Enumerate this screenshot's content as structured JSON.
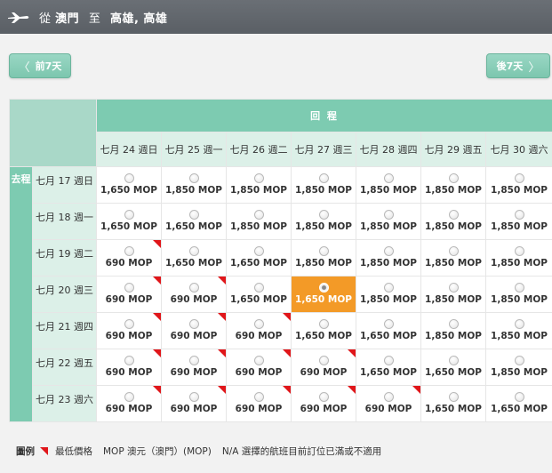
{
  "header": {
    "from": "澳門",
    "to_word": "至",
    "origin_prefix": "從",
    "destination": "高雄, 高雄"
  },
  "nav": {
    "prev_label": "前7天",
    "next_label": "後7天",
    "prev_chev": "〈",
    "next_chev": "〉"
  },
  "grid": {
    "return_title": "回 程",
    "outbound_label": "去程",
    "return_dates": [
      "七月 24 週日",
      "七月 25 週一",
      "七月 26 週二",
      "七月 27 週三",
      "七月 28 週四",
      "七月 29 週五",
      "七月 30 週六"
    ],
    "rows": [
      {
        "date": "七月 17 週日",
        "cells": [
          {
            "price": "1,650 MOP",
            "lowest": false,
            "selected": false
          },
          {
            "price": "1,850 MOP",
            "lowest": false,
            "selected": false
          },
          {
            "price": "1,850 MOP",
            "lowest": false,
            "selected": false
          },
          {
            "price": "1,850 MOP",
            "lowest": false,
            "selected": false
          },
          {
            "price": "1,850 MOP",
            "lowest": false,
            "selected": false
          },
          {
            "price": "1,850 MOP",
            "lowest": false,
            "selected": false
          },
          {
            "price": "1,850 MOP",
            "lowest": false,
            "selected": false
          }
        ]
      },
      {
        "date": "七月 18 週一",
        "cells": [
          {
            "price": "1,650 MOP",
            "lowest": false,
            "selected": false
          },
          {
            "price": "1,650 MOP",
            "lowest": false,
            "selected": false
          },
          {
            "price": "1,850 MOP",
            "lowest": false,
            "selected": false
          },
          {
            "price": "1,850 MOP",
            "lowest": false,
            "selected": false
          },
          {
            "price": "1,850 MOP",
            "lowest": false,
            "selected": false
          },
          {
            "price": "1,850 MOP",
            "lowest": false,
            "selected": false
          },
          {
            "price": "1,850 MOP",
            "lowest": false,
            "selected": false
          }
        ]
      },
      {
        "date": "七月 19 週二",
        "cells": [
          {
            "price": "690 MOP",
            "lowest": true,
            "selected": false
          },
          {
            "price": "1,650 MOP",
            "lowest": false,
            "selected": false
          },
          {
            "price": "1,650 MOP",
            "lowest": false,
            "selected": false
          },
          {
            "price": "1,850 MOP",
            "lowest": false,
            "selected": false
          },
          {
            "price": "1,850 MOP",
            "lowest": false,
            "selected": false
          },
          {
            "price": "1,850 MOP",
            "lowest": false,
            "selected": false
          },
          {
            "price": "1,850 MOP",
            "lowest": false,
            "selected": false
          }
        ]
      },
      {
        "date": "七月 20 週三",
        "cells": [
          {
            "price": "690 MOP",
            "lowest": true,
            "selected": false
          },
          {
            "price": "690 MOP",
            "lowest": true,
            "selected": false
          },
          {
            "price": "1,650 MOP",
            "lowest": false,
            "selected": false
          },
          {
            "price": "1,650 MOP",
            "lowest": false,
            "selected": true
          },
          {
            "price": "1,850 MOP",
            "lowest": false,
            "selected": false
          },
          {
            "price": "1,850 MOP",
            "lowest": false,
            "selected": false
          },
          {
            "price": "1,850 MOP",
            "lowest": false,
            "selected": false
          }
        ]
      },
      {
        "date": "七月 21 週四",
        "cells": [
          {
            "price": "690 MOP",
            "lowest": true,
            "selected": false
          },
          {
            "price": "690 MOP",
            "lowest": true,
            "selected": false
          },
          {
            "price": "690 MOP",
            "lowest": true,
            "selected": false
          },
          {
            "price": "1,650 MOP",
            "lowest": false,
            "selected": false
          },
          {
            "price": "1,650 MOP",
            "lowest": false,
            "selected": false
          },
          {
            "price": "1,850 MOP",
            "lowest": false,
            "selected": false
          },
          {
            "price": "1,850 MOP",
            "lowest": false,
            "selected": false
          }
        ]
      },
      {
        "date": "七月 22 週五",
        "cells": [
          {
            "price": "690 MOP",
            "lowest": true,
            "selected": false
          },
          {
            "price": "690 MOP",
            "lowest": true,
            "selected": false
          },
          {
            "price": "690 MOP",
            "lowest": true,
            "selected": false
          },
          {
            "price": "690 MOP",
            "lowest": true,
            "selected": false
          },
          {
            "price": "1,650 MOP",
            "lowest": false,
            "selected": false
          },
          {
            "price": "1,650 MOP",
            "lowest": false,
            "selected": false
          },
          {
            "price": "1,850 MOP",
            "lowest": false,
            "selected": false
          }
        ]
      },
      {
        "date": "七月 23 週六",
        "cells": [
          {
            "price": "690 MOP",
            "lowest": true,
            "selected": false
          },
          {
            "price": "690 MOP",
            "lowest": true,
            "selected": false
          },
          {
            "price": "690 MOP",
            "lowest": true,
            "selected": false
          },
          {
            "price": "690 MOP",
            "lowest": true,
            "selected": false
          },
          {
            "price": "690 MOP",
            "lowest": true,
            "selected": false
          },
          {
            "price": "1,650 MOP",
            "lowest": false,
            "selected": false
          },
          {
            "price": "1,650 MOP",
            "lowest": false,
            "selected": false
          }
        ]
      }
    ]
  },
  "legend": {
    "title": "圖例",
    "lowest_label": "最低價格",
    "currency_label": "MOP 澳元（澳門）(MOP)",
    "na_label": "N/A 選擇的航班目前訂位已滿或不適用"
  },
  "colors": {
    "accent": "#7dcbb1",
    "selected": "#f39a27",
    "lowest_flag": "#e0161a",
    "header_bg": "#5f646a"
  },
  "icons": {
    "header": "plane-icon",
    "lowest": "red-corner-flag-icon"
  }
}
